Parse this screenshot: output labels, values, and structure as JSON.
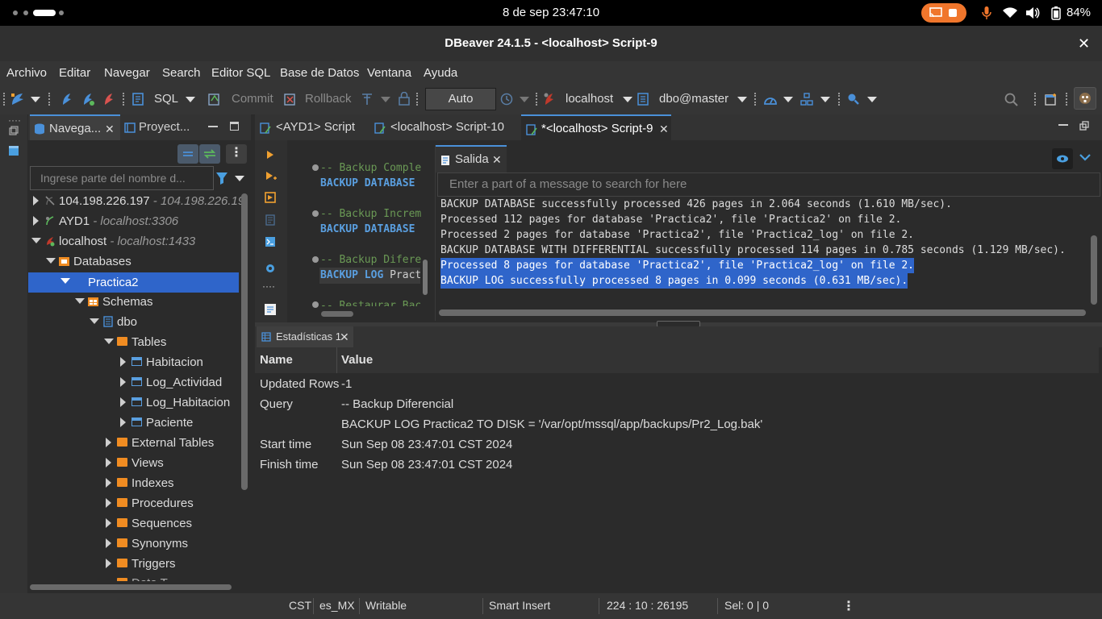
{
  "system": {
    "clock": "8 de sep  23:47:10",
    "battery": "84%"
  },
  "window": {
    "title": "DBeaver 24.1.5 - <localhost> Script-9",
    "close": "✕"
  },
  "menu": [
    "Archivo",
    "Editar",
    "Navegar",
    "Search",
    "Editor SQL",
    "Base de Datos",
    "Ventana",
    "Ayuda"
  ],
  "toolbar": {
    "sql_label": "SQL",
    "commit_label": "Commit",
    "rollback_label": "Rollback",
    "mode": "Auto",
    "datasource": "localhost",
    "schema": "dbo@master"
  },
  "navigator": {
    "tabs": [
      "Navega...",
      "Proyect..."
    ],
    "filter_placeholder": "Ingrese parte del nombre d...",
    "tree": [
      {
        "label": "104.198.226.197",
        "sub": "- 104.198.226.19"
      },
      {
        "label": "AYD1",
        "sub": "- localhost:3306"
      },
      {
        "label": "localhost",
        "sub": "- localhost:1433"
      },
      {
        "label": "Databases"
      },
      {
        "label": "Practica2"
      },
      {
        "label": "Schemas"
      },
      {
        "label": "dbo"
      },
      {
        "label": "Tables"
      },
      {
        "label": "Habitacion"
      },
      {
        "label": "Log_Actividad"
      },
      {
        "label": "Log_Habitacion"
      },
      {
        "label": "Paciente"
      },
      {
        "label": "External Tables"
      },
      {
        "label": "Views"
      },
      {
        "label": "Indexes"
      },
      {
        "label": "Procedures"
      },
      {
        "label": "Sequences"
      },
      {
        "label": "Synonyms"
      },
      {
        "label": "Triggers"
      },
      {
        "label": "Data T..."
      }
    ]
  },
  "editor": {
    "tabs": [
      "<AYD1> Script",
      "<localhost> Script-10",
      "*<localhost> Script-9"
    ],
    "lines": [
      {
        "comment": "-- Backup Comple",
        "kw": "BACKUP DATABASE",
        "rest": ""
      },
      {
        "comment": "-- Backup Increm",
        "kw": "BACKUP DATABASE",
        "rest": ""
      },
      {
        "comment": "-- Backup Difere",
        "kw": "BACKUP LOG",
        "rest": "Pract"
      },
      {
        "comment": "-- Restaurar Bac",
        "kw": "",
        "rest": ""
      }
    ]
  },
  "output": {
    "tab": "Salida",
    "search_placeholder": "Enter a part of a message to search for here",
    "lines": [
      "BACKUP DATABASE successfully processed 426 pages in 2.064 seconds (1.610 MB/sec).",
      "Processed 112 pages for database 'Practica2', file 'Practica2' on file 2.",
      "Processed 2 pages for database 'Practica2', file 'Practica2_log' on file 2.",
      "BACKUP DATABASE WITH DIFFERENTIAL successfully processed 114 pages in 0.785 seconds (1.129 MB/sec).",
      "Processed 8 pages for database 'Practica2', file 'Practica2_log' on file 2.",
      "BACKUP LOG successfully processed 8 pages in 0.099 seconds (0.631 MB/sec)."
    ]
  },
  "stats": {
    "tab": "Estadísticas 1",
    "col_name": "Name",
    "col_value": "Value",
    "rows": [
      {
        "name": "Updated Rows",
        "value": "-1"
      },
      {
        "name": "Query",
        "value": "-- Backup Diferencial"
      },
      {
        "name": "",
        "value": "BACKUP LOG Practica2 TO DISK = '/var/opt/mssql/app/backups/Pr2_Log.bak'"
      },
      {
        "name": "Start time",
        "value": "Sun Sep 08 23:47:01 CST 2024"
      },
      {
        "name": "Finish time",
        "value": "Sun Sep 08 23:47:01 CST 2024"
      }
    ]
  },
  "status": {
    "tz": "CST",
    "locale": "es_MX",
    "write_mode": "Writable",
    "insert_mode": "Smart Insert",
    "position": "224 : 10 : 26195",
    "selection": "Sel: 0 | 0"
  },
  "colors": {
    "accent": "#4a90d9",
    "selection": "#2f65ca",
    "folder": "#f08c22",
    "cast": "#f0762c"
  }
}
